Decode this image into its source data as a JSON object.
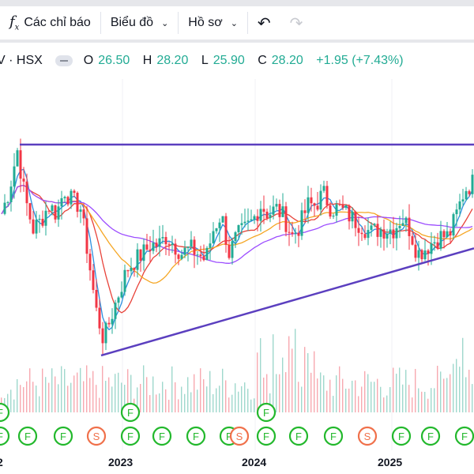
{
  "toolbar": {
    "indicators_label": "Các chỉ báo",
    "chart_label": "Biểu đồ",
    "profile_label": "Hồ sơ",
    "undo_icon": "undo-icon",
    "redo_icon": "redo-icon"
  },
  "legend": {
    "symbol": "V · HSX",
    "open_label": "O",
    "open": "26.50",
    "high_label": "H",
    "high": "28.20",
    "low_label": "L",
    "low": "25.90",
    "close_label": "C",
    "close": "28.20",
    "change": "+1.95 (+7.43%)"
  },
  "colors": {
    "up": "#22ab94",
    "down": "#f23645",
    "resistance": "#5b3fbf",
    "support": "#5b3fbf",
    "ma_blue": "#2c8fe0",
    "ma_red": "#e8433a",
    "ma_orange": "#f5a623",
    "ma_purple": "#9c4dff",
    "event_f": "#22b82c",
    "event_s": "#f0704a"
  },
  "chart_data": {
    "type": "candlestick",
    "closes": [
      24.2,
      25.6,
      27.9,
      25.1,
      23.3,
      23.8,
      24.7,
      24.2,
      25.6,
      24.9,
      24.7,
      21.9,
      18.7,
      16.9,
      18.3,
      19.7,
      21.0,
      21.5,
      21.9,
      22.4,
      22.4,
      22.9,
      22.4,
      21.9,
      22.2,
      21.9,
      21.5,
      23.3,
      24.2,
      21.9,
      22.9,
      23.3,
      23.8,
      24.7,
      24.2,
      24.5,
      24.0,
      22.9,
      23.5,
      24.7,
      24.7,
      25.4,
      24.5,
      24.5,
      24.2,
      23.8,
      23.5,
      23.1,
      23.3,
      23.3,
      23.3,
      24.0,
      23.3,
      21.9,
      22.2,
      22.6,
      22.9,
      22.9,
      24.2,
      25.6,
      26.0
    ],
    "resistance_level": 28.2,
    "support_line": [
      16.0,
      22.2
    ],
    "x_tick_labels": [
      "2",
      "2023",
      "2024",
      "2025"
    ],
    "events_bottom": [
      "F",
      "F",
      "F",
      "S",
      "F",
      "F",
      "F",
      "F",
      "S",
      "F",
      "F",
      "F",
      "S",
      "F",
      "F",
      "F"
    ],
    "events_top": [
      "F",
      "F",
      "F"
    ]
  }
}
